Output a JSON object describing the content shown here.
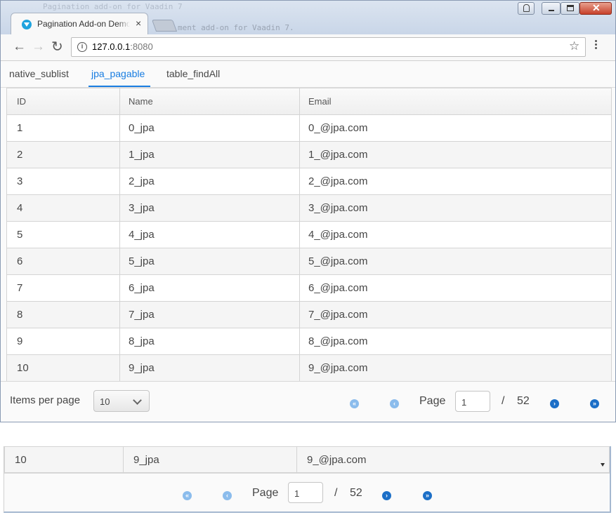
{
  "browser": {
    "tab_title": "Pagination Add-on Demo",
    "tab_close": "×",
    "background_text_1": "Pagination add-on for Vaadin 7",
    "background_text_2": "ment add-on for Vaadin 7.",
    "url_host": "127.0.0.1",
    "url_port": ":8080",
    "icons": {
      "back": "←",
      "forward": "→",
      "reload": "↻",
      "star": "☆",
      "info": "i",
      "close": "✕"
    }
  },
  "tabs": [
    {
      "label": "native_sublist",
      "selected": false
    },
    {
      "label": "jpa_pagable",
      "selected": true
    },
    {
      "label": "table_findAll",
      "selected": false
    }
  ],
  "grid": {
    "columns": [
      "ID",
      "Name",
      "Email"
    ],
    "rows": [
      {
        "id": "1",
        "name": "0_jpa",
        "email": "0_@jpa.com"
      },
      {
        "id": "2",
        "name": "1_jpa",
        "email": "1_@jpa.com"
      },
      {
        "id": "3",
        "name": "2_jpa",
        "email": "2_@jpa.com"
      },
      {
        "id": "4",
        "name": "3_jpa",
        "email": "3_@jpa.com"
      },
      {
        "id": "5",
        "name": "4_jpa",
        "email": "4_@jpa.com"
      },
      {
        "id": "6",
        "name": "5_jpa",
        "email": "5_@jpa.com"
      },
      {
        "id": "7",
        "name": "6_jpa",
        "email": "6_@jpa.com"
      },
      {
        "id": "8",
        "name": "7_jpa",
        "email": "7_@jpa.com"
      },
      {
        "id": "9",
        "name": "8_jpa",
        "email": "8_@jpa.com"
      },
      {
        "id": "10",
        "name": "9_jpa",
        "email": "9_@jpa.com"
      }
    ]
  },
  "pager": {
    "items_per_page_label": "Items per page",
    "items_per_page_value": "10",
    "page_label": "Page",
    "current_page": "1",
    "separator": "/",
    "total_pages": "52",
    "first_glyph": "«",
    "prev_glyph": "‹",
    "next_glyph": "›",
    "last_glyph": "»"
  },
  "zoom_strip": {
    "row": {
      "id": "10",
      "name": "9_jpa",
      "email": "9_@jpa.com"
    },
    "page_label": "Page",
    "current_page": "1",
    "separator": "/",
    "total_pages": "52"
  },
  "colors": {
    "accent": "#197de1",
    "nav_enabled": "#1c6fc7",
    "nav_disabled": "#8bbcec",
    "row_alt": "#f5f5f5"
  }
}
